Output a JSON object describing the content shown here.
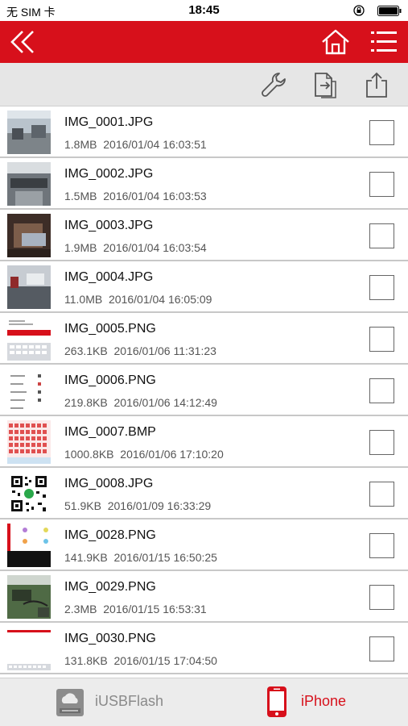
{
  "status": {
    "carrier": "无 SIM 卡",
    "time": "18:45"
  },
  "nav": {
    "back_icon": "double-chevron-left-icon",
    "home_icon": "home-icon",
    "menu_icon": "list-menu-icon",
    "brand_color": "#d7101b"
  },
  "toolbar": {
    "icons": [
      "wrench-icon",
      "copy-icon",
      "share-icon"
    ]
  },
  "files": [
    {
      "name": "IMG_0001.JPG",
      "size": "1.8MB",
      "date": "2016/01/04 16:03:51"
    },
    {
      "name": "IMG_0002.JPG",
      "size": "1.5MB",
      "date": "2016/01/04 16:03:53"
    },
    {
      "name": "IMG_0003.JPG",
      "size": "1.9MB",
      "date": "2016/01/04 16:03:54"
    },
    {
      "name": "IMG_0004.JPG",
      "size": "11.0MB",
      "date": "2016/01/04 16:05:09"
    },
    {
      "name": "IMG_0005.PNG",
      "size": "263.1KB",
      "date": "2016/01/06 11:31:23"
    },
    {
      "name": "IMG_0006.PNG",
      "size": "219.8KB",
      "date": "2016/01/06 14:12:49"
    },
    {
      "name": "IMG_0007.BMP",
      "size": "1000.8KB",
      "date": "2016/01/06 17:10:20"
    },
    {
      "name": "IMG_0008.JPG",
      "size": "51.9KB",
      "date": "2016/01/09 16:33:29"
    },
    {
      "name": "IMG_0028.PNG",
      "size": "141.9KB",
      "date": "2016/01/15 16:50:25"
    },
    {
      "name": "IMG_0029.PNG",
      "size": "2.3MB",
      "date": "2016/01/15 16:53:31"
    },
    {
      "name": "IMG_0030.PNG",
      "size": "131.8KB",
      "date": "2016/01/15 17:04:50"
    }
  ],
  "tabs": {
    "usb_label": "iUSBFlash",
    "phone_label": "iPhone"
  }
}
